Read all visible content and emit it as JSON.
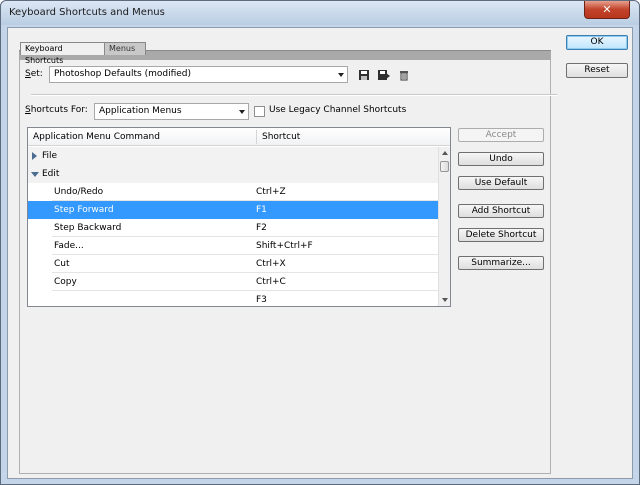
{
  "window": {
    "title": "Keyboard Shortcuts and Menus",
    "close_glyph": "✕"
  },
  "tabs": [
    {
      "label": "Keyboard Shortcuts",
      "active": true
    },
    {
      "label": "Menus",
      "active": false
    }
  ],
  "set": {
    "label": "Set:",
    "value": "Photoshop Defaults (modified)",
    "icons": [
      "save-icon",
      "save-as-icon",
      "delete-icon"
    ]
  },
  "shortcuts_for": {
    "label": "Shortcuts For:",
    "value": "Application Menus"
  },
  "legacy_checkbox": {
    "label": "Use Legacy Channel Shortcuts",
    "checked": false
  },
  "table": {
    "columns": [
      "Application Menu Command",
      "Shortcut"
    ],
    "rows": [
      {
        "type": "group",
        "command": "File",
        "shortcut": "",
        "expanded": false
      },
      {
        "type": "group",
        "command": "Edit",
        "shortcut": "",
        "expanded": true
      },
      {
        "type": "item",
        "command": "Undo/Redo",
        "shortcut": "Ctrl+Z"
      },
      {
        "type": "item",
        "command": "Step Forward",
        "shortcut": "F1",
        "selected": true
      },
      {
        "type": "item",
        "command": "Step Backward",
        "shortcut": "F2"
      },
      {
        "type": "item",
        "command": "Fade...",
        "shortcut": "Shift+Ctrl+F"
      },
      {
        "type": "item",
        "command": "Cut",
        "shortcut": "Ctrl+X"
      },
      {
        "type": "item",
        "command": "Copy",
        "shortcut": "Ctrl+C"
      },
      {
        "type": "item",
        "command": "",
        "shortcut": "F3"
      }
    ]
  },
  "side_buttons": {
    "accept": "Accept",
    "undo": "Undo",
    "use_default": "Use Default",
    "add_shortcut": "Add Shortcut",
    "delete_shortcut": "Delete Shortcut",
    "summarize": "Summarize..."
  },
  "dialog_buttons": {
    "ok": "OK",
    "reset": "Reset"
  },
  "colors": {
    "selection": "#3399ff",
    "window_frame": "#c4d5e9"
  }
}
